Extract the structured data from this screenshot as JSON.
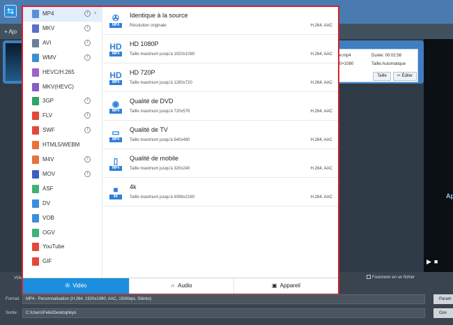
{
  "app": {
    "add_label": "Ajo",
    "info": {
      "format_label": "e:mp4",
      "duration_label": "Durée: 00:02:56",
      "resolution_label": "0×1080",
      "size_label": "Taille:Automatique",
      "size_button": "Taille",
      "edit_button": "Éditer"
    },
    "preview_text": "Ap",
    "bottom": {
      "video_label": "Vide",
      "merge_label": "Fusionner en un fichier",
      "format_label": "Format:",
      "format_value": "MP4 - Personnalisation (H.264, 1920x1080; AAC, 192Kbps, Stéréo)",
      "output_label": "Sortie:",
      "output_value": "C:\\Users\\Felix\\Desktop\\kyo",
      "params_button": "Param",
      "open_button": "Ouv"
    }
  },
  "formats": [
    {
      "label": "MP4",
      "icon": "mp4-icon",
      "color": "#5b8fd9",
      "info": true,
      "chevron": true,
      "selected": true
    },
    {
      "label": "MKV",
      "icon": "mkv-icon",
      "color": "#5a6fc8",
      "info": true
    },
    {
      "label": "AVI",
      "icon": "avi-icon",
      "color": "#6a7f9c",
      "info": true
    },
    {
      "label": "WMV",
      "icon": "wmv-icon",
      "color": "#3b8fd0",
      "info": true
    },
    {
      "label": "HEVC/H.265",
      "icon": "hevc-icon",
      "color": "#9d63c8",
      "info": false
    },
    {
      "label": "MKV(HEVC)",
      "icon": "mkv-hevc-icon",
      "color": "#8a5cc4",
      "info": false
    },
    {
      "label": "3GP",
      "icon": "3gp-icon",
      "color": "#2fa36b",
      "info": true
    },
    {
      "label": "FLV",
      "icon": "flv-icon",
      "color": "#e0493c",
      "info": true
    },
    {
      "label": "SWF",
      "icon": "swf-icon",
      "color": "#e0493c",
      "info": true
    },
    {
      "label": "HTML5/WEBM",
      "icon": "html5-icon",
      "color": "#e5733a",
      "info": false
    },
    {
      "label": "M4V",
      "icon": "m4v-icon",
      "color": "#e5733a",
      "info": true
    },
    {
      "label": "MOV",
      "icon": "mov-icon",
      "color": "#3a5fc2",
      "info": true
    },
    {
      "label": "ASF",
      "icon": "asf-icon",
      "color": "#3fb27a",
      "info": false
    },
    {
      "label": "DV",
      "icon": "dv-icon",
      "color": "#3a8fd9",
      "info": false
    },
    {
      "label": "VOB",
      "icon": "vob-icon",
      "color": "#3a8fd9",
      "info": false
    },
    {
      "label": "OGV",
      "icon": "ogv-icon",
      "color": "#3fb27a",
      "info": false
    },
    {
      "label": "YouTube",
      "icon": "youtube-icon",
      "color": "#e0493c",
      "info": false
    },
    {
      "label": "GIF",
      "icon": "gif-icon",
      "color": "#e0493c",
      "info": false
    }
  ],
  "presets": [
    {
      "title": "Identique à la source",
      "sub": "Résolution originale",
      "codec": "H.264, AAC",
      "icon": "film-reel-icon",
      "glyph": "✇",
      "tag": "MP4"
    },
    {
      "title": "HD 1080P",
      "sub": "Taille maximum jusqu'à 1920x1080",
      "codec": "H.264, AAC",
      "icon": "hd-1080-icon",
      "glyph": "HD",
      "tag": "MP4"
    },
    {
      "title": "HD 720P",
      "sub": "Taille maximum jusqu'à 1280x720",
      "codec": "H.264, AAC",
      "icon": "hd-720-icon",
      "glyph": "HD",
      "tag": "MP4"
    },
    {
      "title": "Qualité de DVD",
      "sub": "Taille maximum jusqu'à 720x576",
      "codec": "H.264, AAC",
      "icon": "dvd-icon",
      "glyph": "◉",
      "tag": "MP4"
    },
    {
      "title": "Qualité de TV",
      "sub": "Taille maximum jusqu'à 640x480",
      "codec": "H.264, AAC",
      "icon": "tv-icon",
      "glyph": "▭",
      "tag": "MP4"
    },
    {
      "title": "Qualité de mobile",
      "sub": "Taille maximum jusqu'à 320x240",
      "codec": "H.264, AAC",
      "icon": "mobile-icon",
      "glyph": "▯",
      "tag": "MP4"
    },
    {
      "title": "4k",
      "sub": "Taille maximum jusqu'à 4096x2160",
      "codec": "H.264, AAC",
      "icon": "4k-camera-icon",
      "glyph": "■",
      "tag": "4K"
    }
  ],
  "tabs": [
    {
      "label": "Vidéo",
      "icon": "video-reel-icon",
      "glyph": "✇",
      "active": true
    },
    {
      "label": "Audio",
      "icon": "headphones-icon",
      "glyph": "∩",
      "active": false
    },
    {
      "label": "Appareil",
      "icon": "device-icon",
      "glyph": "▣",
      "active": false
    }
  ]
}
